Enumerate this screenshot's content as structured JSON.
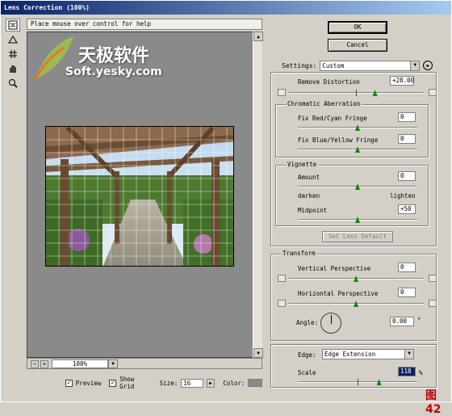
{
  "window": {
    "title": "Lens Correction (100%)"
  },
  "hint": "Place mouse over control for help",
  "tools": [
    {
      "icon": "remove-distortion-tool-icon"
    },
    {
      "icon": "straighten-tool-icon"
    },
    {
      "icon": "move-grid-tool-icon"
    },
    {
      "icon": "hand-tool-icon"
    },
    {
      "icon": "zoom-tool-icon"
    }
  ],
  "watermark": {
    "brand": "天极软件",
    "site": "Soft.yesky.com"
  },
  "zoom": {
    "value": "100%"
  },
  "bottom": {
    "preview_label": "Preview",
    "preview_checked": true,
    "grid_label": "Show Grid",
    "grid_checked": true,
    "size_label": "Size:",
    "size_value": "16",
    "color_label": "Color:"
  },
  "buttons": {
    "ok": "OK",
    "cancel": "Cancel"
  },
  "settings": {
    "label": "Settings:",
    "value": "Custom"
  },
  "distortion": {
    "label": "Remove Distortion",
    "value": "+28.00",
    "level": 0.64
  },
  "chromatic": {
    "title": "Chromatic Aberration",
    "red_label": "Fix Red/Cyan Fringe",
    "red_value": "0",
    "blue_label": "Fix Blue/Yellow Fringe",
    "blue_value": "0"
  },
  "vignette": {
    "title": "Vignette",
    "amount_label": "Amount",
    "amount_value": "0",
    "darken": "darken",
    "lighten": "lighten",
    "midpoint_label": "Midpoint",
    "midpoint_value": "+50"
  },
  "set_default": "Set Lens Default",
  "transform": {
    "title": "Transform",
    "vertical_label": "Vertical Perspective",
    "vertical_value": "0",
    "horizontal_label": "Horizontal Perspective",
    "horizontal_value": "0",
    "angle_label": "Angle:",
    "angle_value": "0.00",
    "angle_unit": "°",
    "edge_label": "Edge:",
    "edge_value": "Edge Extension",
    "scale_label": "Scale",
    "scale_value": "118",
    "scale_unit": "%",
    "scale_level": 0.68
  },
  "figure_label": "图42"
}
